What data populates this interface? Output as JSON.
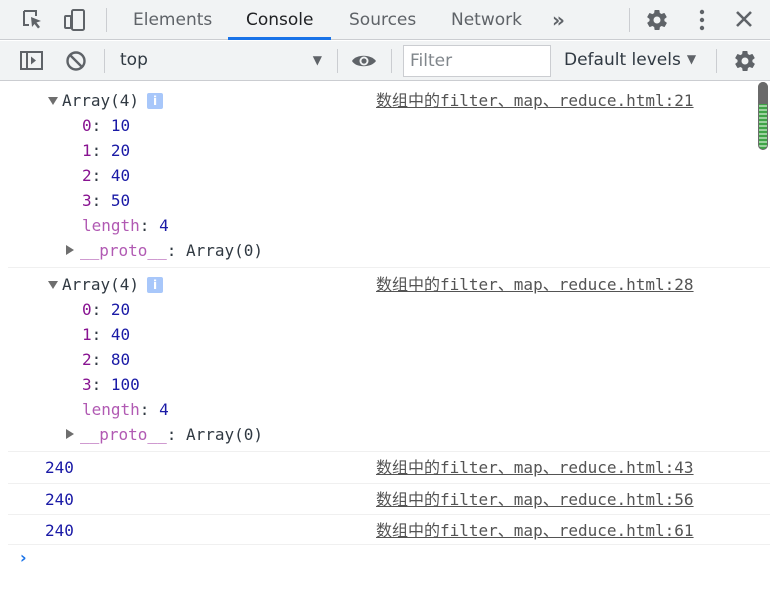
{
  "tabs": {
    "items": [
      "Elements",
      "Console",
      "Sources",
      "Network"
    ],
    "active": "Console",
    "more_label": "»"
  },
  "toolbar": {
    "context": "top",
    "filter_placeholder": "Filter",
    "levels_label": "Default levels"
  },
  "icons": {
    "inspect": "inspect-element-icon",
    "device": "device-toolbar-icon",
    "settings": "gear-icon",
    "menu": "kebab-menu-icon",
    "close": "close-icon",
    "sidebar": "console-sidebar-icon",
    "clear": "clear-console-icon",
    "eye": "eye-icon"
  },
  "colors": {
    "accent": "#1a73e8",
    "key": "#881391",
    "number": "#1a1aa6"
  },
  "console": {
    "messages": [
      {
        "header": "Array(4)",
        "info": "i",
        "source": "数组中的filter、map、reduce.html:21",
        "entries": [
          {
            "key": "0",
            "value": "10"
          },
          {
            "key": "1",
            "value": "20"
          },
          {
            "key": "2",
            "value": "40"
          },
          {
            "key": "3",
            "value": "50"
          }
        ],
        "length_key": "length",
        "length_value": "4",
        "proto_key": "__proto__",
        "proto_value": "Array(0)"
      },
      {
        "header": "Array(4)",
        "info": "i",
        "source": "数组中的filter、map、reduce.html:28",
        "entries": [
          {
            "key": "0",
            "value": "20"
          },
          {
            "key": "1",
            "value": "40"
          },
          {
            "key": "2",
            "value": "80"
          },
          {
            "key": "3",
            "value": "100"
          }
        ],
        "length_key": "length",
        "length_value": "4",
        "proto_key": "__proto__",
        "proto_value": "Array(0)"
      },
      {
        "value": "240",
        "source": "数组中的filter、map、reduce.html:43"
      },
      {
        "value": "240",
        "source": "数组中的filter、map、reduce.html:56"
      },
      {
        "value": "240",
        "source": "数组中的filter、map、reduce.html:61"
      }
    ],
    "prompt": "›"
  }
}
